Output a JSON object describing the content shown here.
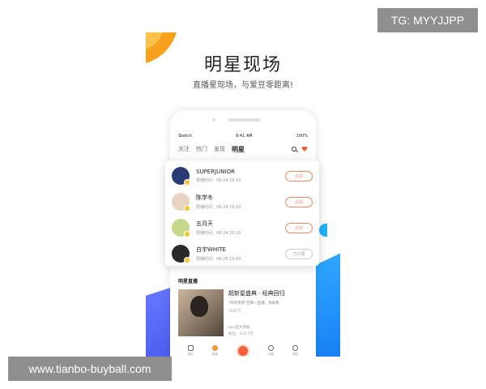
{
  "watermarks": {
    "tg": "TG: MYYJJPP",
    "site": "www.tianbo-buyball.com"
  },
  "promo": {
    "headline": "明星现场",
    "subline": "直播星现场，与爱豆零距离!"
  },
  "phone": {
    "status_left": "Sketch",
    "status_time": "9:41 AM",
    "status_right": "100%",
    "tabs": [
      {
        "label": "关注"
      },
      {
        "label": "热门"
      },
      {
        "label": "发现"
      },
      {
        "label": "明星"
      }
    ],
    "icons": {
      "search": "search-icon",
      "gem": "diamond-icon"
    },
    "stars": [
      {
        "name": "SUPERJUNIOR",
        "time": "预播时间：08-24 19:30",
        "button": "订阅",
        "avatar_color": "#2b3a73",
        "subscribed": false
      },
      {
        "name": "陈学冬",
        "time": "预播时间：08-24 19:30",
        "button": "订阅",
        "avatar_color": "#e9d3c2",
        "subscribed": false
      },
      {
        "name": "五月天",
        "time": "预播时间：08-24 20:30",
        "button": "订阅",
        "avatar_color": "#c6d98a",
        "subscribed": false
      },
      {
        "name": "白宇WHITE",
        "time": "预播时间：08-26 19:00",
        "button": "已订阅",
        "avatar_color": "#2a2a2a",
        "subscribed": true
      }
    ],
    "live": {
      "section_title": "明星直播",
      "name": "超新星盛典 · 经典回归",
      "desc": "\"你的贵宾\"空降一直播，快来看",
      "views": "2895万",
      "host": "lulu是大师姐",
      "fans": "粉丝：114.7万"
    },
    "tabbar": [
      {
        "label": "首页"
      },
      {
        "label": "频道"
      },
      {
        "label": ""
      },
      {
        "label": "消息"
      },
      {
        "label": "我的"
      }
    ]
  },
  "colors": {
    "accent": "#f0875a",
    "orange": "#f7a11d",
    "blue": "#1275f0"
  }
}
